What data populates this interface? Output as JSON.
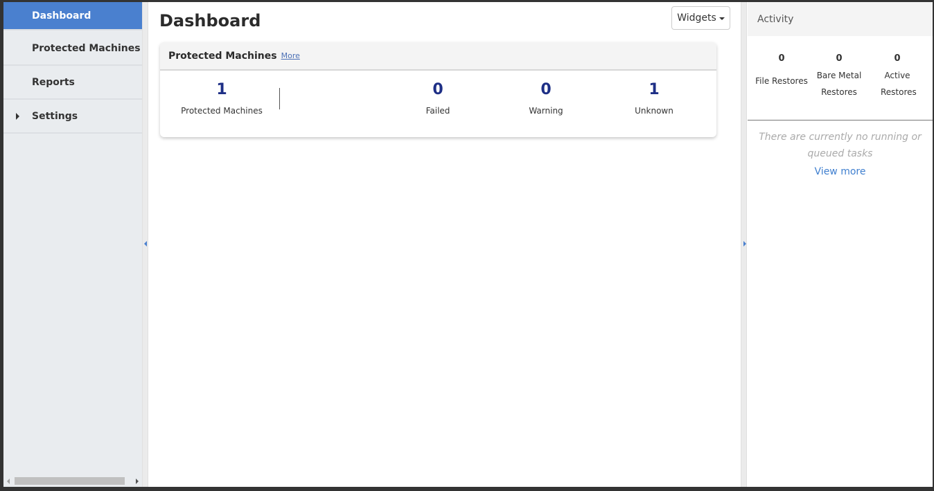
{
  "sidebar": {
    "items": [
      {
        "label": "Dashboard",
        "active": true
      },
      {
        "label": "Protected Machines"
      },
      {
        "label": "Reports"
      },
      {
        "label": "Settings",
        "expandable": true
      }
    ]
  },
  "main": {
    "title": "Dashboard",
    "widgets_label": "Widgets",
    "card": {
      "title": "Protected Machines",
      "more_label": "More",
      "stats": [
        {
          "value": "1",
          "label": "Protected Machines"
        },
        {
          "value": "0",
          "label": "Failed"
        },
        {
          "value": "0",
          "label": "Warning"
        },
        {
          "value": "1",
          "label": "Unknown"
        }
      ]
    }
  },
  "activity": {
    "title": "Activity",
    "stats": [
      {
        "value": "0",
        "label": "File Restores"
      },
      {
        "value": "0",
        "label": "Bare Metal Restores"
      },
      {
        "value": "0",
        "label": "Active Restores"
      }
    ],
    "empty_message": "There are currently no running or queued tasks",
    "view_more_label": "View more"
  },
  "colors": {
    "accent": "#4a80cf",
    "stat_number": "#1e2f86",
    "link": "#3f7fcf"
  }
}
